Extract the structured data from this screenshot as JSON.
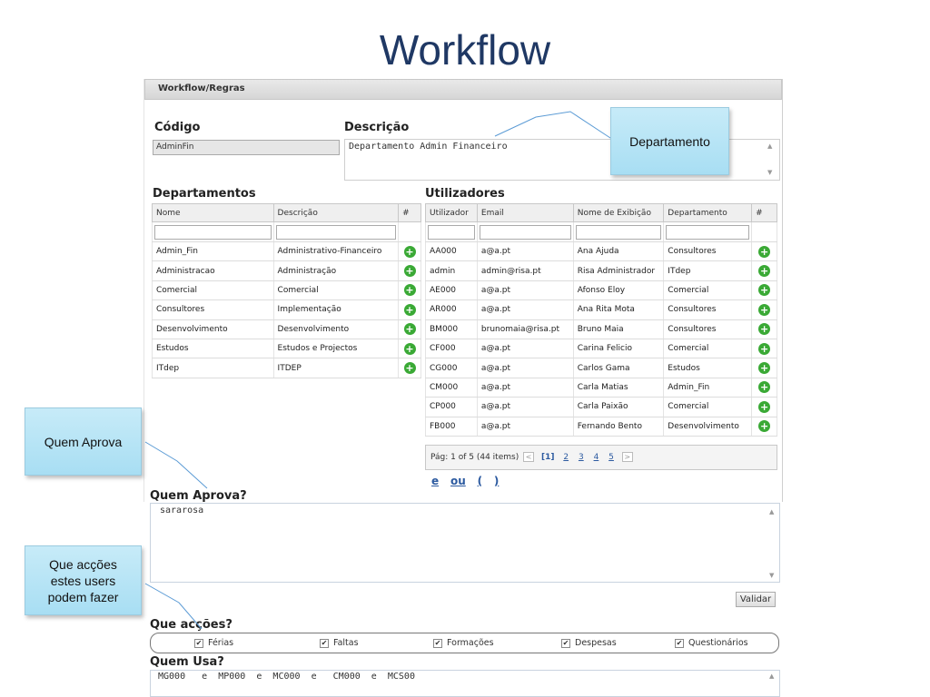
{
  "slide_title": "Workflow",
  "panel_header": "Workflow/Regras",
  "codigo": {
    "label": "Código",
    "value": "AdminFin"
  },
  "descricao": {
    "label": "Descrição",
    "value": "Departamento Admin Financeiro"
  },
  "departamentos": {
    "title": "Departamentos",
    "columns": [
      "Nome",
      "Descrição",
      "#"
    ],
    "rows": [
      [
        "Admin_Fin",
        "Administrativo-Financeiro"
      ],
      [
        "Administracao",
        "Administração"
      ],
      [
        "Comercial",
        "Comercial"
      ],
      [
        "Consultores",
        "Implementação"
      ],
      [
        "Desenvolvimento",
        "Desenvolvimento"
      ],
      [
        "Estudos",
        "Estudos e Projectos"
      ],
      [
        "ITdep",
        "ITDEP"
      ]
    ]
  },
  "utilizadores": {
    "title": "Utilizadores",
    "columns": [
      "Utilizador",
      "Email",
      "Nome de Exibição",
      "Departamento",
      "#"
    ],
    "rows": [
      [
        "AA000",
        "a@a.pt",
        "Ana Ajuda",
        "Consultores"
      ],
      [
        "admin",
        "admin@risa.pt",
        "Risa Administrador",
        "ITdep"
      ],
      [
        "AE000",
        "a@a.pt",
        "Afonso Eloy",
        "Comercial"
      ],
      [
        "AR000",
        "a@a.pt",
        "Ana Rita Mota",
        "Consultores"
      ],
      [
        "BM000",
        "brunomaia@risa.pt",
        "Bruno Maia",
        "Consultores"
      ],
      [
        "CF000",
        "a@a.pt",
        "Carina Felicio",
        "Comercial"
      ],
      [
        "CG000",
        "a@a.pt",
        "Carlos Gama",
        "Estudos"
      ],
      [
        "CM000",
        "a@a.pt",
        "Carla Matias",
        "Admin_Fin"
      ],
      [
        "CP000",
        "a@a.pt",
        "Carla Paixão",
        "Comercial"
      ],
      [
        "FB000",
        "a@a.pt",
        "Fernando Bento",
        "Desenvolvimento"
      ]
    ],
    "pager": {
      "info": "Pág: 1 of 5 (44 items)",
      "current": "[1]",
      "pages": [
        "2",
        "3",
        "4",
        "5"
      ]
    }
  },
  "operators": [
    "e",
    "ou",
    "(",
    ")"
  ],
  "quem_aprova": {
    "label": "Quem Aprova?",
    "value": "sararosa"
  },
  "validar_label": "Validar",
  "que_accoes": {
    "label": "Que acções?",
    "items": [
      "Férias",
      "Faltas",
      "Formações",
      "Despesas",
      "Questionários"
    ]
  },
  "quem_usa": {
    "label": "Quem Usa?",
    "value": "MG000   e  MP000  e  MC000  e   CM000  e  MCS00"
  },
  "callouts": {
    "departamento": "Departamento",
    "quem_aprova": "Quem Aprova",
    "que_accoes": "Que acções estes users podem fazer"
  }
}
